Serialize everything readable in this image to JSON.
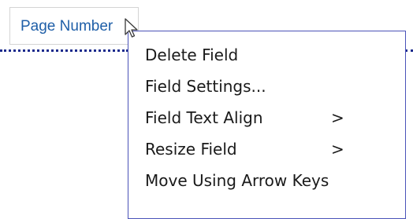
{
  "field": {
    "label": "Page Number"
  },
  "context_menu": {
    "items": [
      {
        "label": "Delete Field",
        "submenu_arrow": ""
      },
      {
        "label": "Field Settings...",
        "submenu_arrow": ""
      },
      {
        "label": "Field Text Align",
        "submenu_arrow": ">"
      },
      {
        "label": "Resize Field",
        "submenu_arrow": ">"
      },
      {
        "label": "Move Using Arrow Keys",
        "submenu_arrow": ""
      }
    ]
  },
  "colors": {
    "field_text": "#1f5fa8",
    "dotted_line": "#1a2a8c",
    "menu_border": "#4a52b8"
  },
  "icons": {
    "pointer": "arrow-cursor-icon"
  }
}
